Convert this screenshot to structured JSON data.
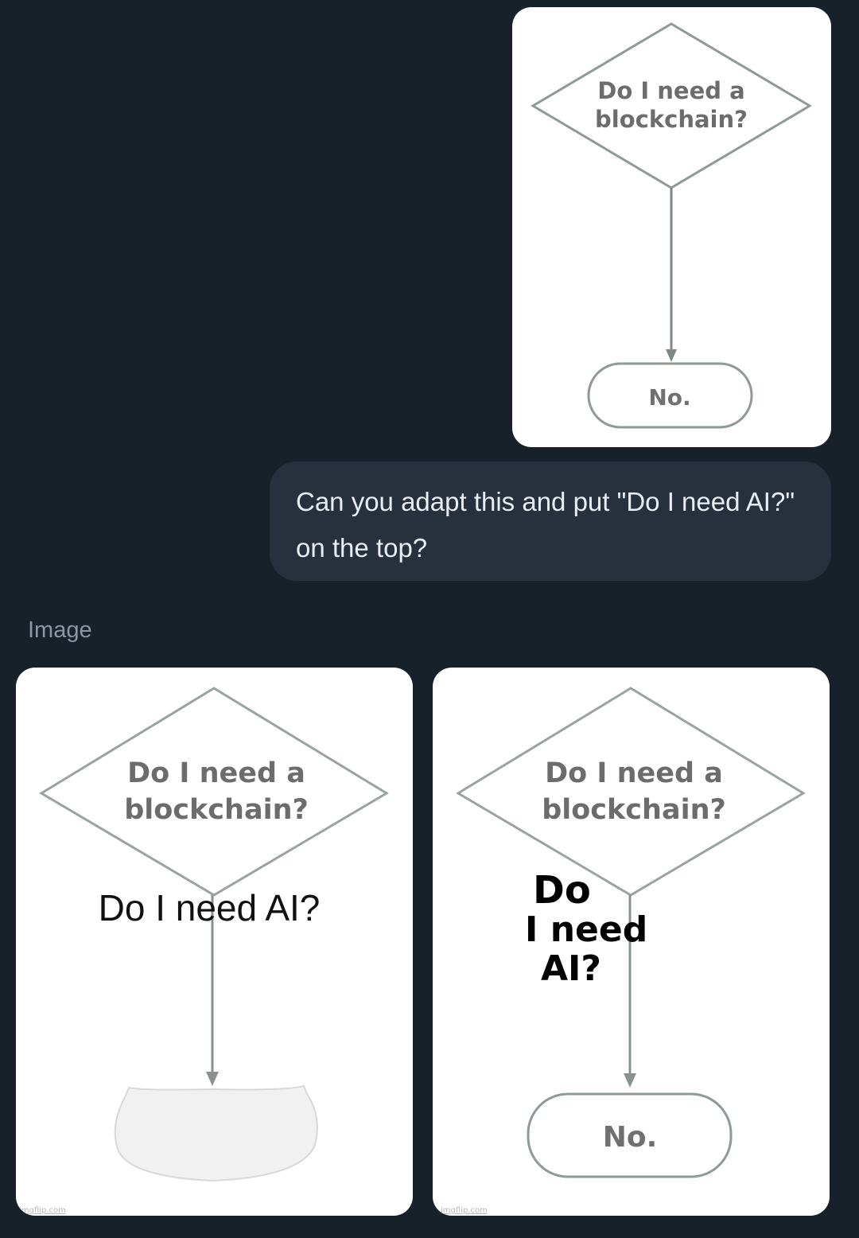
{
  "user_message": {
    "text_line1": "Can you adapt this and put \"Do I need AI?\"",
    "text_line2": "on the top?"
  },
  "original_flowchart": {
    "question_line1": "Do I need a",
    "question_line2": "blockchain?",
    "answer": "No."
  },
  "response": {
    "label": "Image",
    "results": [
      {
        "question_line1": "Do I need a",
        "question_line2": "blockchain?",
        "overlay_text": "Do I need AI?",
        "watermark": "imgflip.com"
      },
      {
        "question_line1": "Do I need a",
        "question_line2": "blockchain?",
        "overlay_line1": "Do",
        "overlay_line2": "I need",
        "overlay_line3": "AI?",
        "answer": "No.",
        "watermark": "imgflip.com"
      }
    ]
  }
}
